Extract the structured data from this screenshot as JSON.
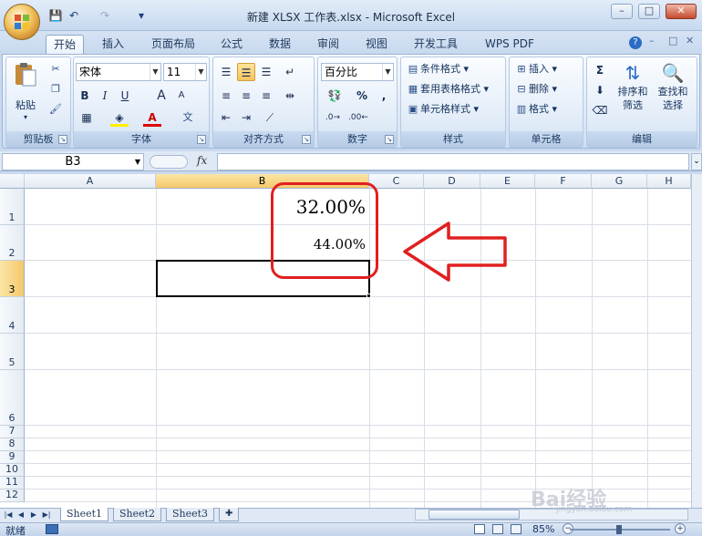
{
  "window": {
    "title": "新建 XLSX 工作表.xlsx - Microsoft Excel"
  },
  "quick_access": {
    "save": "💾",
    "undo": "↶",
    "redo": "↷",
    "customize": "▾"
  },
  "tabs": [
    {
      "label": "开始",
      "active": true
    },
    {
      "label": "插入"
    },
    {
      "label": "页面布局"
    },
    {
      "label": "公式"
    },
    {
      "label": "数据"
    },
    {
      "label": "审阅"
    },
    {
      "label": "视图"
    },
    {
      "label": "开发工具"
    },
    {
      "label": "WPS PDF"
    }
  ],
  "ribbon": {
    "clipboard": {
      "label": "剪贴板",
      "paste": "粘贴"
    },
    "font": {
      "label": "字体",
      "name": "宋体",
      "size": "11",
      "bold": "B",
      "italic": "I",
      "underline": "U",
      "grow": "A",
      "shrink": "A",
      "font_color_letter": "A",
      "phonetic": "文"
    },
    "alignment": {
      "label": "对齐方式"
    },
    "number": {
      "label": "数字",
      "format": "百分比",
      "percent": "%",
      "comma": ","
    },
    "styles": {
      "label": "样式",
      "conditional": "条件格式",
      "table": "套用表格格式",
      "cell_styles": "单元格样式"
    },
    "cells": {
      "label": "单元格",
      "insert": "插入",
      "delete": "删除",
      "format": "格式"
    },
    "editing": {
      "label": "编辑",
      "sort_line1": "排序和",
      "sort_line2": "筛选",
      "find_line1": "查找和",
      "find_line2": "选择"
    }
  },
  "formula_bar": {
    "name_box": "B3",
    "fx": "fx",
    "value": ""
  },
  "columns": [
    "A",
    "B",
    "C",
    "D",
    "E",
    "F",
    "G",
    "H"
  ],
  "rows": [
    "1",
    "2",
    "3",
    "4",
    "5",
    "6",
    "7",
    "8",
    "9",
    "10",
    "11",
    "12"
  ],
  "cells": {
    "B1": "32.00%",
    "B2": "44.00%"
  },
  "selected_cell": "B3",
  "sheets": [
    "Sheet1",
    "Sheet2",
    "Sheet3"
  ],
  "active_sheet": "Sheet1",
  "status": {
    "text": "就绪",
    "zoom": "85%"
  },
  "colors": {
    "annotation": "#e02020",
    "selection": "#000000",
    "header_selected": "#f5c86b"
  },
  "watermark": {
    "text": "Bai经验",
    "sub": "jingyan.baidu.com"
  }
}
